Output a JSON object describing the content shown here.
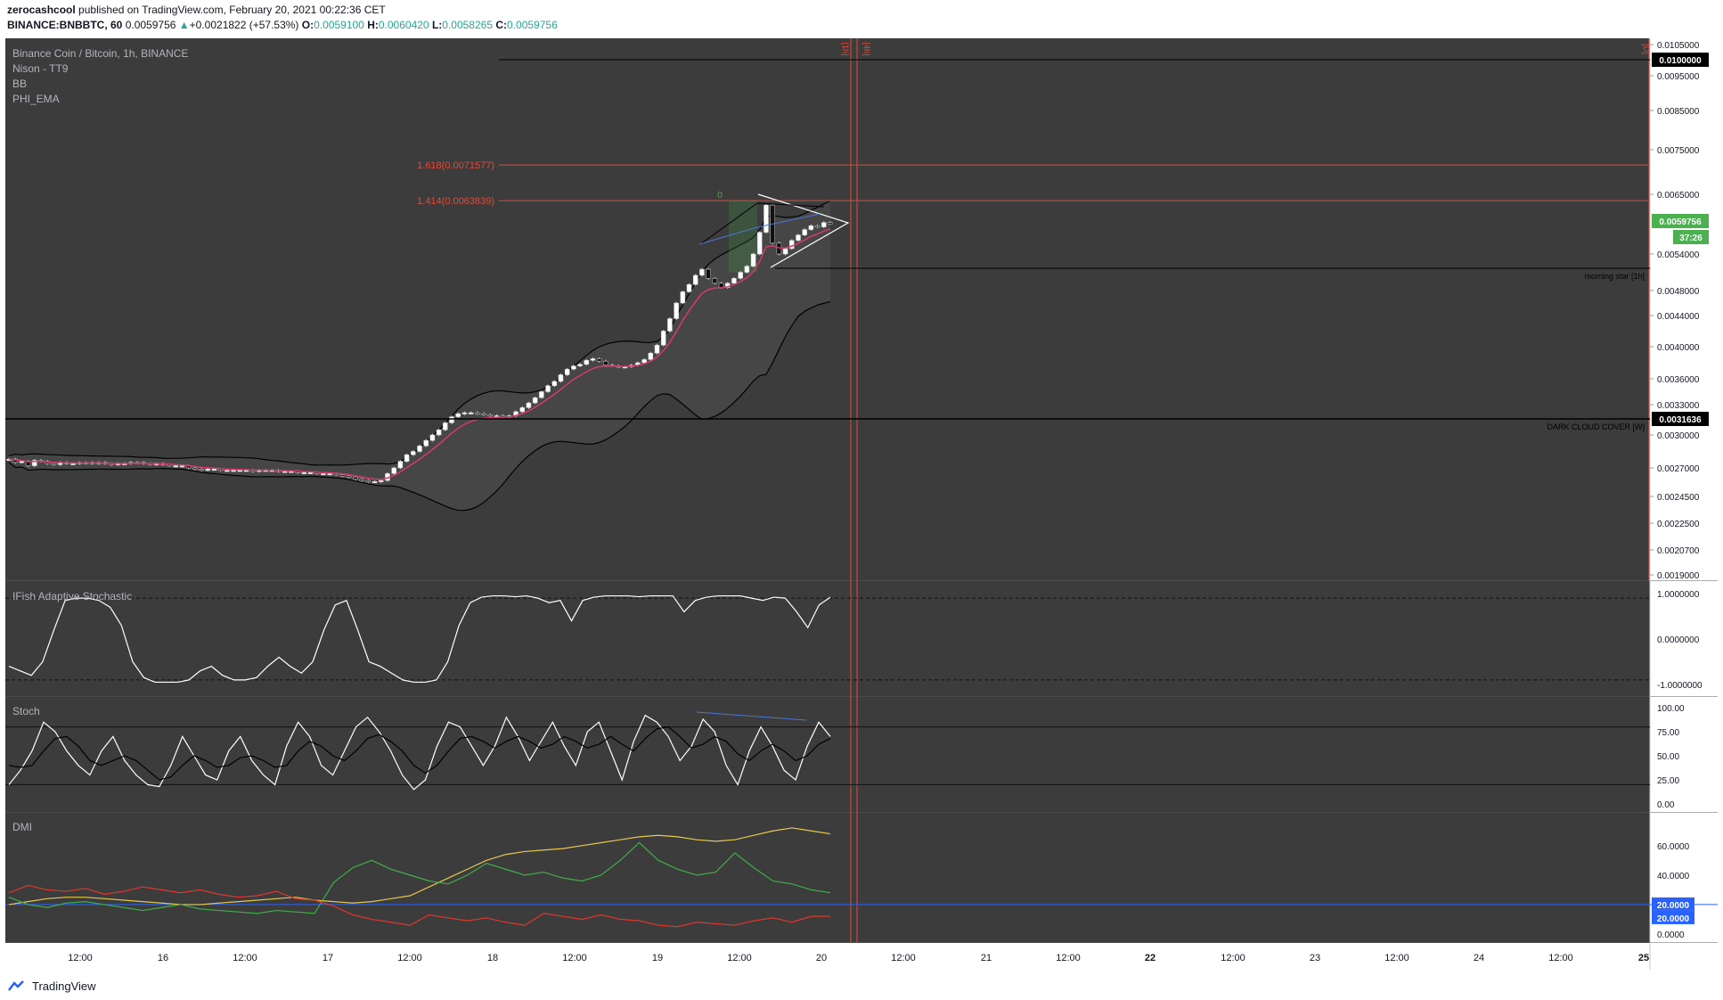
{
  "header": {
    "author": "zerocashcool",
    "published_text": "published on TradingView.com, February 20, 2021 00:22:36 CET",
    "symbol": "BINANCE:BNBBTC, 60",
    "price": "0.0059756",
    "change": "+0.0021822 (+57.53%)",
    "o_label": "O:",
    "o_value": "0.0059100",
    "h_label": "H:",
    "h_value": "0.0060420",
    "l_label": "L:",
    "l_value": "0.0058265",
    "c_label": "C:",
    "c_value": "0.0059756"
  },
  "legend": {
    "title": "Binance Coin / Bitcoin, 1h, BINANCE",
    "indicators": [
      "Nison - TT9",
      "BB",
      "PHI_EMA"
    ]
  },
  "colors": {
    "panel_bg": "#3c3c3c",
    "grid": "#505050",
    "candle_up": "#ffffff",
    "candle_down": "#111111",
    "bb": "#000000",
    "ema": "#d63a6b",
    "fib": "#e04a3a",
    "stoch_k": "#ffffff",
    "stoch_d": "#000000",
    "adx": "#e6c84a",
    "plus_di": "#3fae49",
    "minus_di": "#e0362c",
    "dmi_level": "#2962ff",
    "price_badge": "#4caf50"
  },
  "footer": {
    "brand": "TradingView",
    "icon": "tradingview-logo-icon"
  },
  "chart_data": [
    {
      "type": "line",
      "title": "Binance Coin / Bitcoin, 1h, BINANCE",
      "description_series": "BNBBTC hourly candles, Bollinger Bands, EMA",
      "x_ticks": [
        "12:00",
        "16",
        "12:00",
        "17",
        "12:00",
        "18",
        "12:00",
        "19",
        "12:00",
        "20",
        "12:00",
        "21",
        "12:00",
        "22",
        "12:00",
        "23",
        "12:00",
        "24",
        "12:00",
        "25"
      ],
      "y_ticks": [
        "0.0105000",
        "0.0095000",
        "0.0085000",
        "0.0075000",
        "0.0065000",
        "0.0054000",
        "0.0048000",
        "0.0044000",
        "0.0040000",
        "0.0036000",
        "0.0033000",
        "0.0030000",
        "0.0027000",
        "0.0024500",
        "0.0022500",
        "0.0020700",
        "0.0019000"
      ],
      "price_labels": {
        "level_top": "0.0100000",
        "current_price": "0.0059756",
        "countdown": "37:26",
        "support": "0.0031636"
      },
      "fib_levels": [
        {
          "label": "1.618(0.0071577)",
          "value": 0.0071577
        },
        {
          "label": "1.414(0.0063839)",
          "value": 0.0063839
        }
      ],
      "fib_zero_label": "0",
      "annotations": [
        "morning star [1h]",
        "DARK CLOUD COVER [W]"
      ],
      "session_markers": [
        "[1h]",
        "[4h]",
        "[D]"
      ],
      "close_series": [
        0.00278,
        0.00275,
        0.00276,
        0.00272,
        0.00277,
        0.00276,
        0.00274,
        0.00273,
        0.00275,
        0.00274,
        0.00274,
        0.00275,
        0.00275,
        0.00274,
        0.00275,
        0.00274,
        0.00273,
        0.00274,
        0.00274,
        0.00275,
        0.00275,
        0.00274,
        0.00273,
        0.00274,
        0.00273,
        0.00272,
        0.00272,
        0.00272,
        0.0027,
        0.00269,
        0.00268,
        0.00269,
        0.00269,
        0.00268,
        0.00268,
        0.00268,
        0.00268,
        0.00268,
        0.00267,
        0.00268,
        0.00268,
        0.00268,
        0.00267,
        0.00267,
        0.00267,
        0.00266,
        0.00266,
        0.00266,
        0.00265,
        0.00265,
        0.00265,
        0.00264,
        0.00263,
        0.00262,
        0.0026,
        0.00259,
        0.00258,
        0.00258,
        0.00259,
        0.00265,
        0.0027,
        0.00276,
        0.00282,
        0.00285,
        0.0029,
        0.00295,
        0.003,
        0.00305,
        0.00312,
        0.00318,
        0.00321,
        0.00322,
        0.00322,
        0.00321,
        0.0032,
        0.00319,
        0.00319,
        0.00318,
        0.00319,
        0.00323,
        0.00327,
        0.00332,
        0.00338,
        0.00345,
        0.00352,
        0.00357,
        0.00365,
        0.00372,
        0.00376,
        0.00378,
        0.00383,
        0.00385,
        0.00382,
        0.00377,
        0.00376,
        0.00375,
        0.00375,
        0.00377,
        0.0038,
        0.00384,
        0.00392,
        0.00402,
        0.0042,
        0.00436,
        0.0046,
        0.00478,
        0.0049,
        0.00505,
        0.00515,
        0.005,
        0.00492,
        0.00485,
        0.00492,
        0.005,
        0.0051,
        0.0052,
        0.0054,
        0.0058,
        0.0063,
        0.0056,
        0.0054,
        0.0055,
        0.00565,
        0.00575,
        0.00585,
        0.00592,
        0.0059,
        0.00598,
        0.00597
      ]
    },
    {
      "type": "line",
      "title": "IFish Adaptive Stochastic",
      "y_ticks": [
        "1.0000000",
        "0.0000000",
        "-1.0000000"
      ],
      "levels": [
        0.9,
        -0.9
      ],
      "series": [
        {
          "values": [
            -0.6,
            -0.7,
            -0.8,
            -0.5,
            0.2,
            0.85,
            0.9,
            0.9,
            0.85,
            0.7,
            0.3,
            -0.5,
            -0.85,
            -0.95,
            -0.95,
            -0.95,
            -0.9,
            -0.7,
            -0.6,
            -0.8,
            -0.9,
            -0.9,
            -0.85,
            -0.6,
            -0.4,
            -0.6,
            -0.75,
            -0.5,
            0.2,
            0.75,
            0.85,
            0.2,
            -0.5,
            -0.6,
            -0.75,
            -0.9,
            -0.95,
            -0.95,
            -0.9,
            -0.5,
            0.3,
            0.8,
            0.92,
            0.95,
            0.95,
            0.93,
            0.95,
            0.9,
            0.8,
            0.85,
            0.4,
            0.85,
            0.92,
            0.95,
            0.95,
            0.95,
            0.93,
            0.95,
            0.95,
            0.95,
            0.6,
            0.85,
            0.92,
            0.95,
            0.95,
            0.95,
            0.9,
            0.85,
            0.92,
            0.9,
            0.6,
            0.25,
            0.75,
            0.92
          ]
        }
      ]
    },
    {
      "type": "line",
      "title": "Stoch",
      "y_ticks": [
        "100.00",
        "75.00",
        "50.00",
        "25.00",
        "0.00"
      ],
      "levels": [
        80,
        20
      ],
      "series": [
        {
          "values": [
            20,
            35,
            55,
            85,
            75,
            55,
            40,
            30,
            55,
            70,
            45,
            30,
            20,
            18,
            40,
            70,
            50,
            30,
            25,
            55,
            70,
            45,
            30,
            20,
            60,
            85,
            70,
            40,
            30,
            55,
            80,
            90,
            75,
            55,
            30,
            15,
            25,
            60,
            85,
            80,
            60,
            40,
            60,
            90,
            70,
            45,
            65,
            85,
            60,
            40,
            75,
            85,
            55,
            25,
            65,
            92,
            85,
            70,
            45,
            60,
            88,
            75,
            40,
            20,
            55,
            80,
            60,
            35,
            25,
            60,
            85,
            70
          ]
        },
        {
          "values": [
            40,
            38,
            40,
            55,
            68,
            70,
            60,
            45,
            40,
            45,
            50,
            45,
            35,
            25,
            28,
            40,
            50,
            45,
            38,
            40,
            48,
            50,
            45,
            38,
            40,
            55,
            65,
            60,
            50,
            45,
            55,
            68,
            72,
            65,
            55,
            40,
            32,
            40,
            55,
            68,
            70,
            65,
            58,
            65,
            70,
            65,
            58,
            62,
            70,
            65,
            58,
            62,
            70,
            62,
            55,
            68,
            78,
            80,
            70,
            58,
            62,
            70,
            65,
            52,
            45,
            55,
            62,
            55,
            45,
            50,
            62,
            68
          ]
        }
      ]
    },
    {
      "type": "line",
      "title": "DMI",
      "y_ticks": [
        "60.0000",
        "40.0000",
        "20.0000",
        "0.0000"
      ],
      "level_labels": [
        "20.0000",
        "20.0000"
      ],
      "series": [
        {
          "values": [
            20,
            22,
            24,
            25,
            25,
            24,
            23,
            22,
            21,
            20,
            20,
            21,
            22,
            23,
            24,
            25,
            23,
            22,
            21,
            22,
            24,
            26,
            32,
            38,
            44,
            50,
            54,
            56,
            57,
            58,
            60,
            62,
            64,
            66,
            67,
            66,
            64,
            63,
            64,
            67,
            70,
            72,
            70,
            68
          ]
        },
        {
          "values": [
            25,
            20,
            18,
            21,
            22,
            20,
            18,
            16,
            18,
            20,
            17,
            16,
            15,
            14,
            16,
            15,
            14,
            35,
            45,
            50,
            44,
            40,
            36,
            34,
            40,
            48,
            44,
            40,
            42,
            38,
            36,
            40,
            50,
            62,
            50,
            44,
            40,
            42,
            55,
            45,
            36,
            34,
            30,
            28
          ]
        },
        {
          "values": [
            28,
            33,
            30,
            29,
            31,
            27,
            29,
            32,
            30,
            28,
            30,
            27,
            25,
            26,
            29,
            24,
            23,
            19,
            13,
            10,
            8,
            6,
            13,
            11,
            9,
            11,
            8,
            6,
            14,
            12,
            10,
            13,
            10,
            9,
            6,
            5,
            8,
            7,
            6,
            9,
            11,
            8,
            12,
            12
          ]
        }
      ]
    }
  ]
}
